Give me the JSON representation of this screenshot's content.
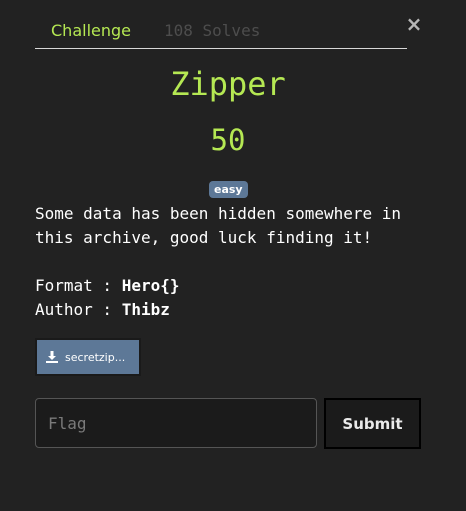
{
  "modal": {
    "close_label": "×",
    "tabs": [
      {
        "label": "Challenge"
      },
      {
        "label": "108 Solves"
      }
    ],
    "title": "Zipper",
    "points": "50",
    "difficulty": "easy",
    "description": {
      "lines": [
        "Some data has been hidden somewhere in",
        "this archive, good luck finding it!"
      ],
      "format_label": "Format : ",
      "format_value": "Hero{}",
      "author_label": "Author : ",
      "author_value": "Thibz"
    },
    "file_button_label": "secretzip...",
    "flag_input": {
      "placeholder": "Flag",
      "value": ""
    },
    "submit_label": "Submit"
  },
  "colors": {
    "background": "#222222",
    "accent": "#b5e853",
    "badge": "#5d7897",
    "inactive_tab": "#4d4d4d"
  }
}
